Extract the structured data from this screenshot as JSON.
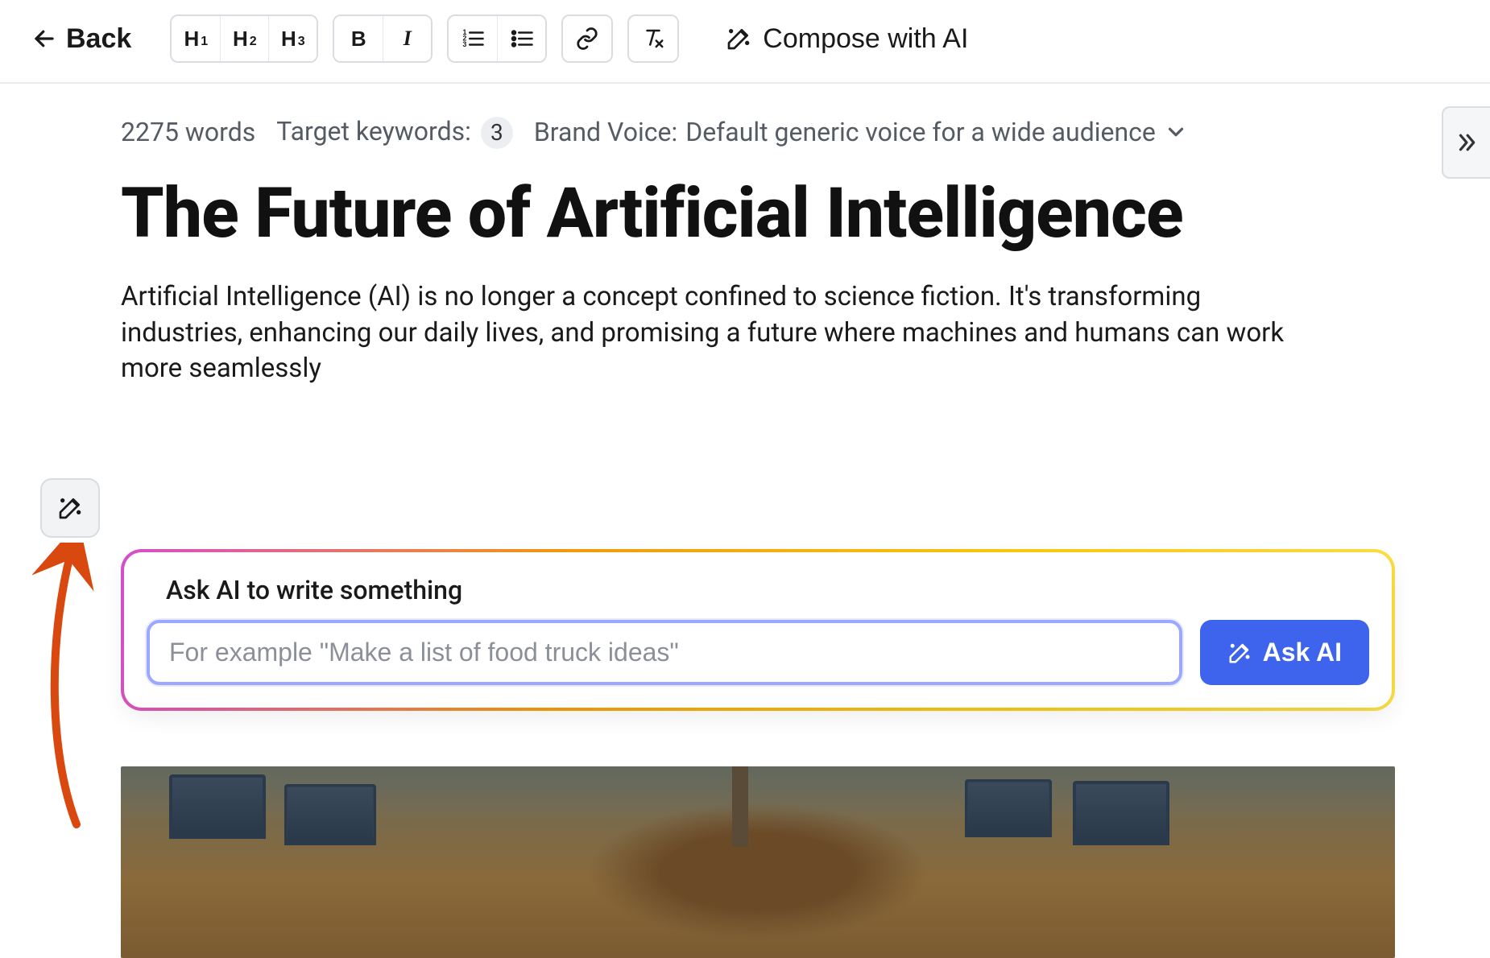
{
  "toolbar": {
    "back_label": "Back",
    "h1": "H",
    "h1_sub": "1",
    "h2": "H",
    "h2_sub": "2",
    "h3": "H",
    "h3_sub": "3",
    "bold": "B",
    "italic": "I",
    "compose_label": "Compose with AI"
  },
  "meta": {
    "word_count": "2275 words",
    "target_keywords_label": "Target keywords:",
    "target_keywords_count": "3",
    "brand_voice_label": "Brand Voice:",
    "brand_voice_value": "Default generic voice for a wide audience"
  },
  "doc": {
    "title": "The Future of Artificial Intelligence",
    "paragraph": "Artificial Intelligence (AI) is no longer a concept confined to science fiction. It's transforming industries, enhancing our daily lives, and promising a future where machines and humans can work more seamlessly"
  },
  "ask_ai": {
    "title": "Ask AI to write something",
    "placeholder": "For example \"Make a list of food truck ideas\"",
    "button": "Ask AI"
  },
  "icons": {
    "arrow_left": "arrow-left",
    "chevron_down": "chevron-down",
    "double_chevron_right": "double-chevron-right",
    "wand": "wand"
  }
}
